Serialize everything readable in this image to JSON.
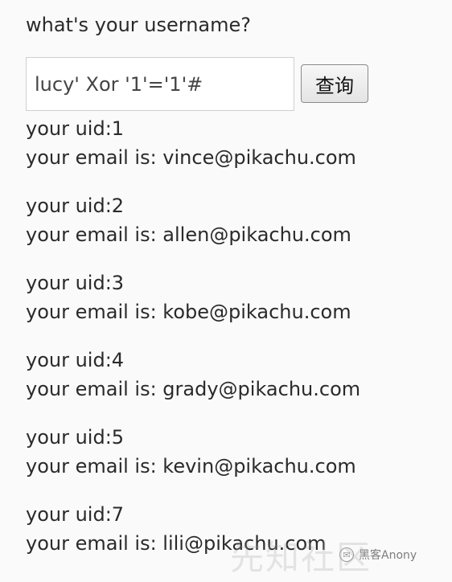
{
  "page": {
    "question": "what's your username?",
    "search": {
      "input_value": "lucy' Xor '1'='1'#",
      "button_label": "查询"
    },
    "results": [
      {
        "uid_line": "your uid:1",
        "email_line": "your email is: vince@pikachu.com"
      },
      {
        "uid_line": "your uid:2",
        "email_line": "your email is: allen@pikachu.com"
      },
      {
        "uid_line": "your uid:3",
        "email_line": "your email is: kobe@pikachu.com"
      },
      {
        "uid_line": "your uid:4",
        "email_line": "your email is: grady@pikachu.com"
      },
      {
        "uid_line": "your uid:5",
        "email_line": "your email is: kevin@pikachu.com"
      },
      {
        "uid_line": "your uid:7",
        "email_line": "your email is: lili@pikachu.com"
      }
    ]
  },
  "watermark": {
    "faded_text": "先知社区",
    "wechat_label": "黑客Anony",
    "icon": "wechat-icon"
  }
}
